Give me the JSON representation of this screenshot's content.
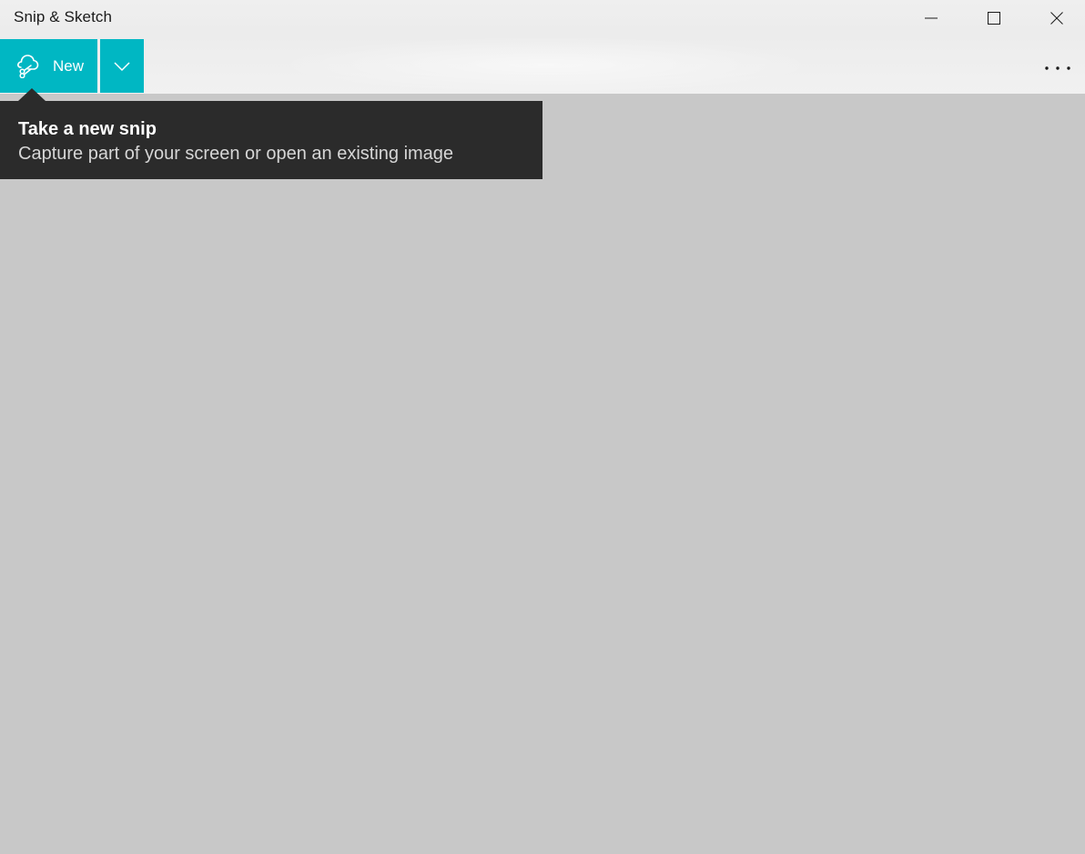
{
  "window": {
    "title": "Snip & Sketch"
  },
  "caption": {
    "minimize_icon": "minimize-icon",
    "maximize_icon": "maximize-icon",
    "close_icon": "close-icon"
  },
  "toolbar": {
    "new_label": "New",
    "new_icon": "snip-scissors-icon",
    "dropdown_icon": "chevron-down-icon",
    "more_icon": "more-ellipsis-icon"
  },
  "tooltip": {
    "title": "Take a new snip",
    "description": "Capture part of your screen or open an existing image"
  },
  "colors": {
    "accent": "#00b7c3",
    "canvas": "#c8c8c8",
    "tooltip_bg": "#2b2b2b"
  }
}
